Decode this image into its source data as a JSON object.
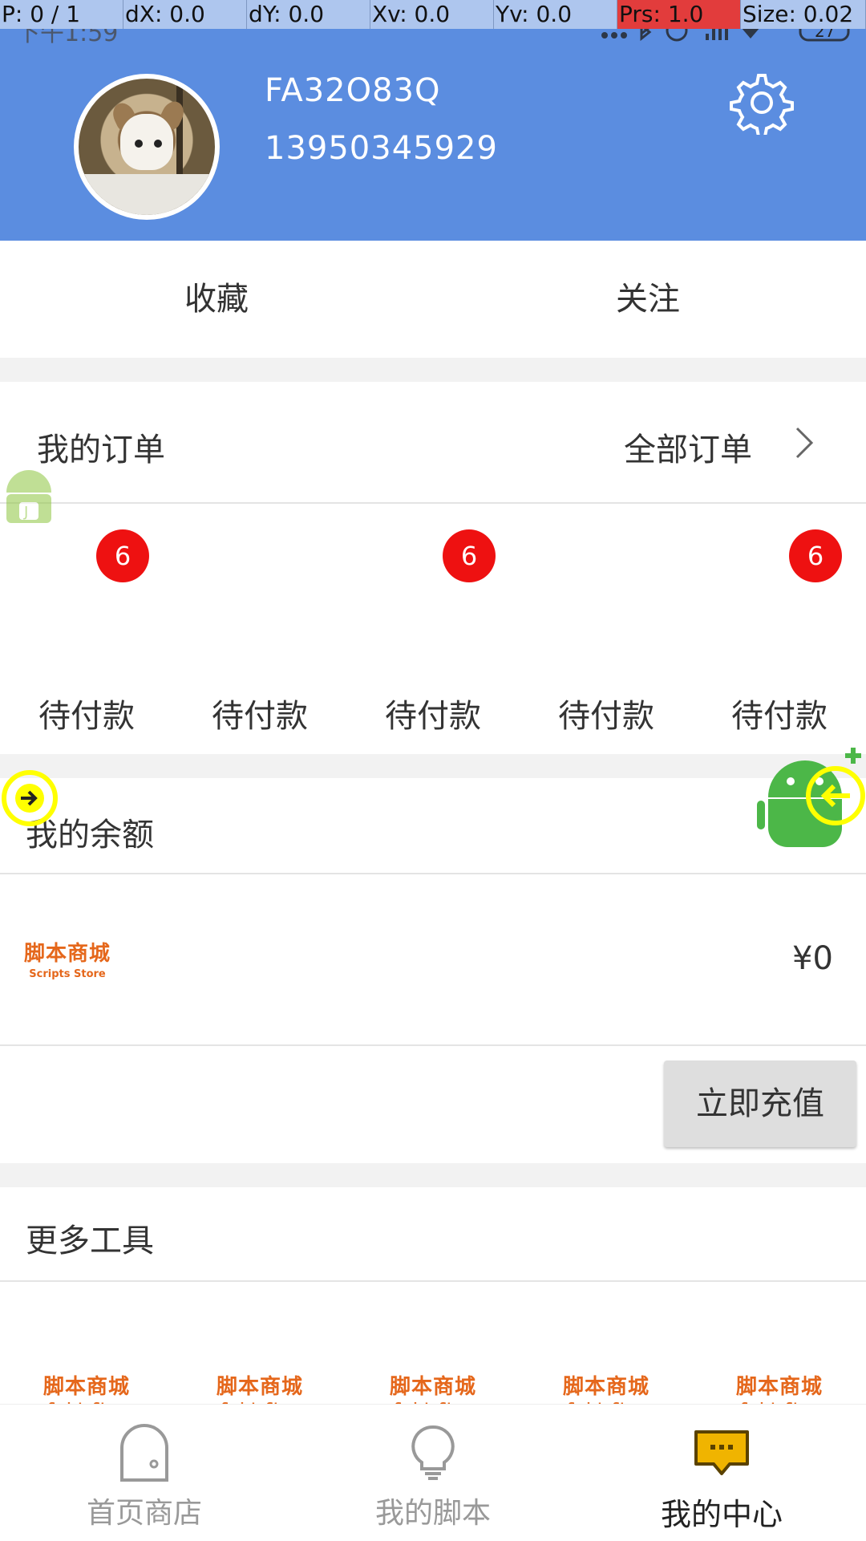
{
  "debug_bar": {
    "pointer": "P: 0 / 1",
    "dx": "dX: 0.0",
    "dy": "dY: 0.0",
    "xv": "Xv: 0.0",
    "yv": "Yv: 0.0",
    "prs": "Prs: 1.0",
    "size": "Size: 0.02"
  },
  "status_bar": {
    "time": "下午1:59",
    "battery": "27"
  },
  "profile": {
    "username": "FA32O83Q",
    "phone": "13950345929"
  },
  "tabs": {
    "favorites": "收藏",
    "following": "关注"
  },
  "orders": {
    "title": "我的订单",
    "all_link": "全部订单",
    "badges": [
      "6",
      "6",
      "6"
    ],
    "statuses": [
      "待付款",
      "待付款",
      "待付款",
      "待付款",
      "待付款"
    ]
  },
  "balance": {
    "title": "我的余额",
    "value": "¥0",
    "recharge_label": "立即充值"
  },
  "logo": {
    "cn": "脚本商城",
    "en": "Scripts Store"
  },
  "tools": {
    "title": "更多工具"
  },
  "bottom_nav": {
    "items": [
      {
        "label": "首页商店",
        "icon": "home-store-icon",
        "active": false
      },
      {
        "label": "我的脚本",
        "icon": "lightbulb-icon",
        "active": false
      },
      {
        "label": "我的中心",
        "icon": "chat-center-icon",
        "active": true
      }
    ]
  },
  "colors": {
    "header_blue": "#5b8de0",
    "badge_red": "#ee1111",
    "logo_orange": "#e5671b",
    "nav_active_icon": "#f0b400"
  }
}
